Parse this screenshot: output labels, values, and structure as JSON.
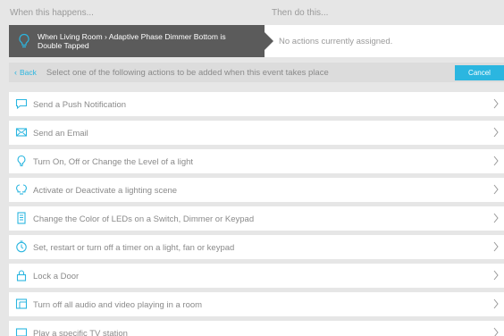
{
  "header": {
    "when_label": "When this happens...",
    "then_label": "Then do this..."
  },
  "event": {
    "text": "When Living Room › Adaptive Phase Dimmer Bottom is Double Tapped",
    "icon": "lightbulb-icon"
  },
  "actions_placeholder": "No actions currently assigned.",
  "toolbar": {
    "back_label": "Back",
    "instructions": "Select one of the following actions to be added when this event takes place",
    "cancel_label": "Cancel"
  },
  "colors": {
    "accent": "#2bb6e0",
    "event_bg": "#5b5b5b",
    "page_bg": "#e6e6e6"
  },
  "actions": [
    {
      "label": "Send a Push Notification",
      "icon": "chat-bubble-icon"
    },
    {
      "label": "Send an Email",
      "icon": "envelope-icon"
    },
    {
      "label": "Turn On, Off or Change the Level of a light",
      "icon": "lightbulb-icon"
    },
    {
      "label": "Activate or Deactivate a lighting scene",
      "icon": "scene-icon"
    },
    {
      "label": "Change the Color of LEDs on a Switch, Dimmer or Keypad",
      "icon": "keypad-icon"
    },
    {
      "label": "Set, restart or turn off a timer on a light, fan or keypad",
      "icon": "timer-icon"
    },
    {
      "label": "Lock a Door",
      "icon": "lock-icon"
    },
    {
      "label": "Turn off all audio and video playing in a room",
      "icon": "room-media-icon"
    },
    {
      "label": "Play a specific TV station",
      "icon": "tv-icon"
    }
  ]
}
